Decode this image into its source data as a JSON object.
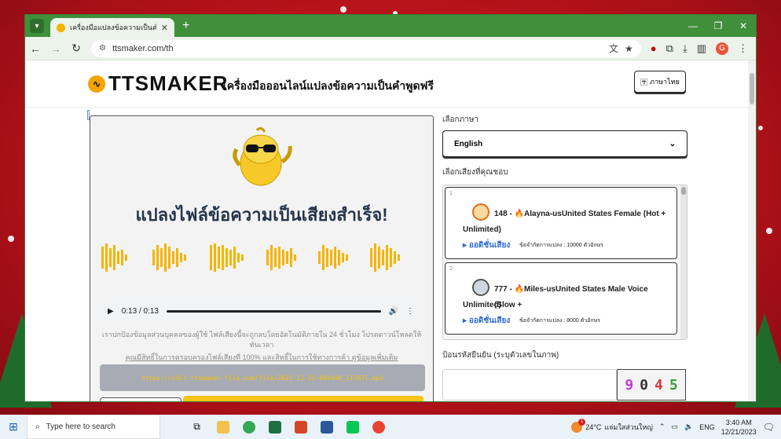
{
  "browser": {
    "tab_title": "เครื่องมือแปลงข้อความเป็นคำพูดออนไ",
    "url": "ttsmaker.com/th"
  },
  "site": {
    "logo_text": "TTSMAKER",
    "tagline": "เครื่องมือออนไลน์แปลงข้อความเป็นคำพูดฟรี",
    "language_button": "ภาษาไทย"
  },
  "result": {
    "title": "แปลงไฟล์ข้อความเป็นเสียงสำเร็จ!",
    "audio_time": "0:13 / 0:13",
    "notice": "เราปกป้องข้อมูลส่วนบุคคลของผู้ใช้ ไฟล์เสียงนี้จะถูกลบโดยอัตโนมัติภายใน 24 ชั่วโมง โปรดดาวน์โหลดให้ทันเวลา",
    "rights_link": "คุณมีสิทธิ์ในการครอบครองไฟล์เสียงที่ 100% และสิทธิ์ในการใช้ทางการค้า ดูข้อมูลเพิ่มเติม",
    "file_url": "https://s3cl.ttsmaker-file.com/file/2023-12-21-004446_117671.mp3"
  },
  "form": {
    "language_label": "เลือกภาษา",
    "language_value": "English",
    "voice_label": "เลือกเสียงที่คุณชอบ",
    "voices": [
      {
        "index": "1",
        "name": "148 - 🔥Alayna-usUnited States Female (Hot +",
        "name_cont": "Unlimited)",
        "listen": "ออดิชั่นเสียง",
        "limit": "ข้อจำกัดการแปลง : 10000 ตัวอักษร"
      },
      {
        "index": "2",
        "name": "777 - 🔥Miles-usUnited States Male Voice (Slow +",
        "name_cont": "Unlimited)",
        "listen": "ออดิชั่นเสียง",
        "limit": "ข้อจำกัดการแปลง : 8000 ตัวอักษร"
      }
    ],
    "captcha_label": "ป้อนรหัสยืนยัน (ระบุตัวเลขในภาพ)",
    "captcha_digits": [
      "9",
      "0",
      "4",
      "5"
    ]
  },
  "taskbar": {
    "search_placeholder": "Type here to search",
    "weather_temp": "24°C",
    "weather_desc": "แจ่มใสส่วนใหญ่",
    "weather_badge": "1",
    "lang": "ENG",
    "time": "3:40 AM",
    "date": "12/21/2023"
  }
}
